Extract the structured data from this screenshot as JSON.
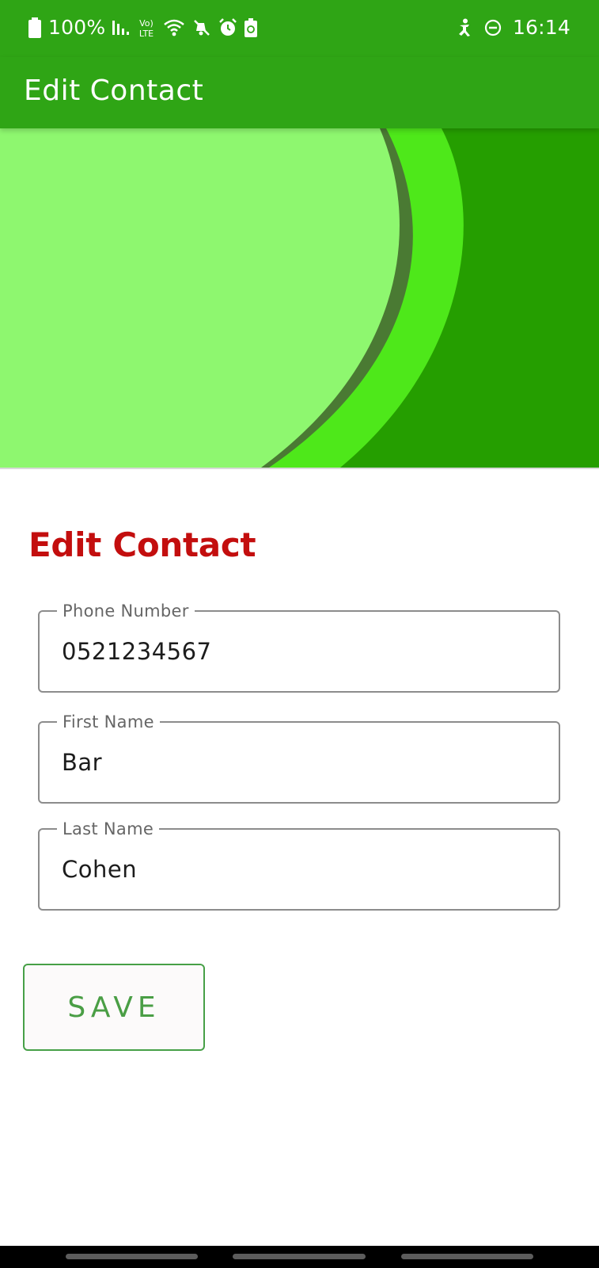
{
  "status_bar": {
    "battery_percent": "100%",
    "network_label": "Vo) LTE",
    "time": "16:14",
    "icons_left": [
      "battery-icon",
      "signal-icon",
      "volte-icon",
      "wifi-icon",
      "mute-icon",
      "alarm-icon",
      "battery-saver-icon"
    ],
    "icons_right": [
      "accessibility-icon",
      "do-not-disturb-icon"
    ]
  },
  "app_bar": {
    "title": "Edit Contact"
  },
  "form": {
    "heading": "Edit Contact",
    "fields": [
      {
        "label": "Phone Number",
        "value": "0521234567"
      },
      {
        "label": "First Name",
        "value": "Bar"
      },
      {
        "label": "Last Name",
        "value": "Cohen"
      }
    ],
    "save_label": "SAVE"
  },
  "colors": {
    "primary": "#2fa515",
    "heading_red": "#c30e0e",
    "button_green": "#4a9e45",
    "banner_light": "#8ef76f",
    "banner_bright": "#4ee81a",
    "banner_dark": "#259e00",
    "banner_stroke": "#4a7a33"
  }
}
